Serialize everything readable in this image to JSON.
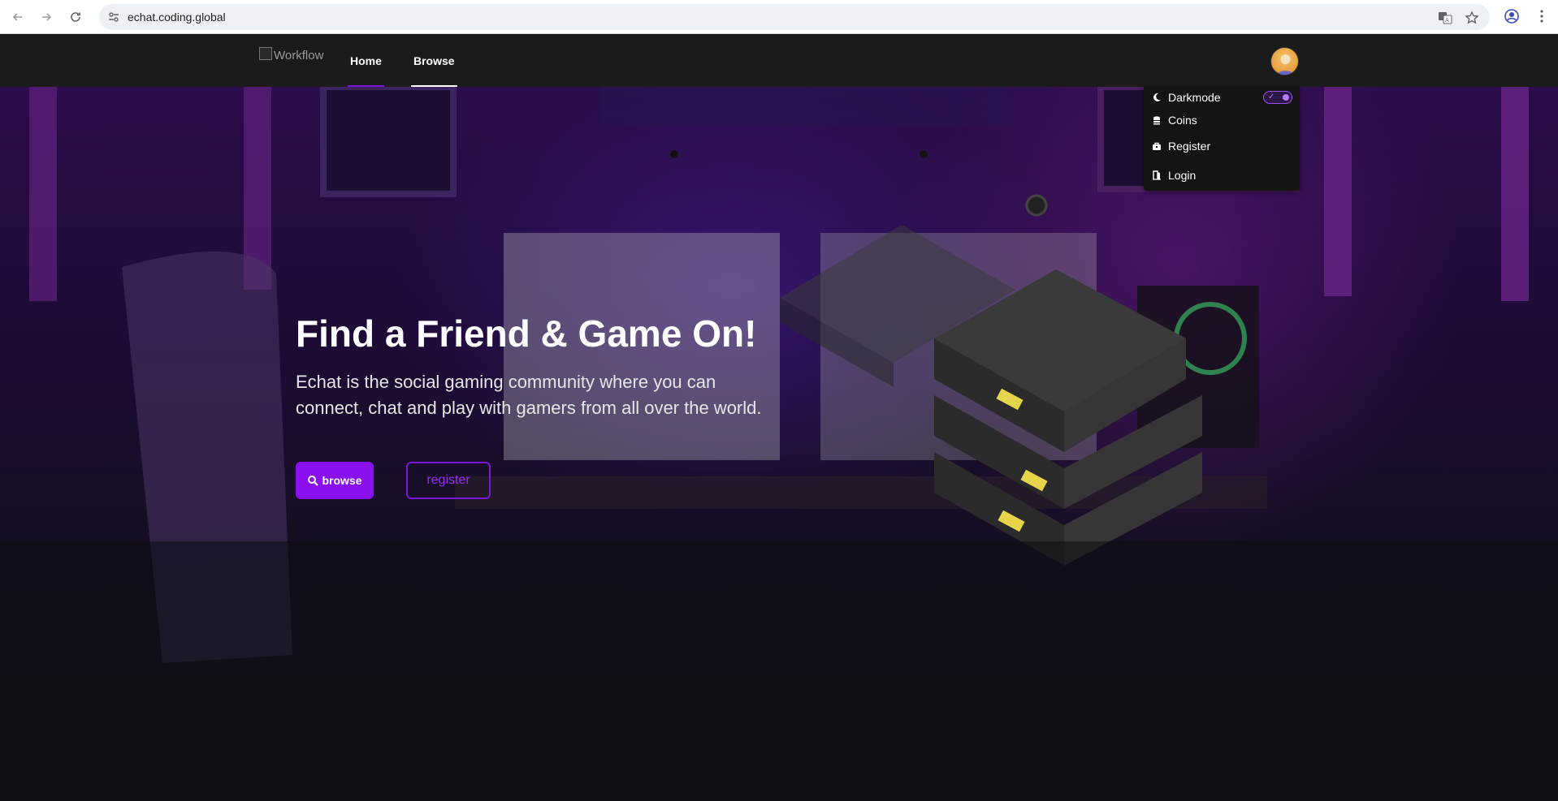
{
  "browser": {
    "url": "echat.coding.global"
  },
  "header": {
    "logo_alt": "Workflow",
    "nav": [
      {
        "label": "Home",
        "accent": "#7a17d8"
      },
      {
        "label": "Browse",
        "accent": "#ffffff"
      }
    ]
  },
  "dropdown": {
    "items": [
      {
        "label": "Darkmode",
        "icon": "moon-icon"
      },
      {
        "label": "Coins",
        "icon": "coins-icon"
      },
      {
        "label": "Register",
        "icon": "register-icon"
      },
      {
        "label": "Login",
        "icon": "login-icon"
      }
    ],
    "darkmode_on": true
  },
  "hero": {
    "title": "Find a Friend & Game On!",
    "text": "Echat is the social gaming community where you can connect, chat and play with gamers from all over the world.",
    "browse_label": "browse",
    "register_label": "register"
  },
  "colors": {
    "accent": "#8a10f0",
    "topbar": "#1b1b1b"
  }
}
